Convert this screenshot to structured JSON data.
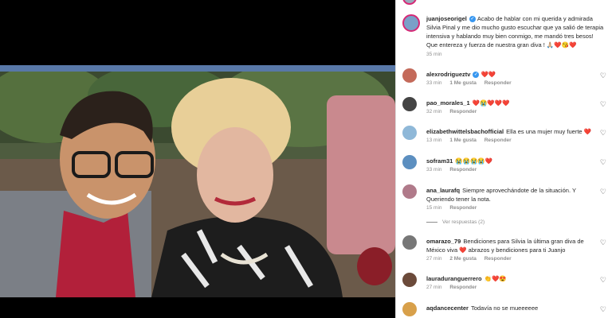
{
  "post": {
    "caption": {
      "username": "juanjoseorigel",
      "text": "Acabo de hablar con mi querida y admirada Silvia Pinal y me dio mucho gusto escuchar que ya salió de terapia intensiva y hablando muy bien conmigo, me mandó tres besos! Que entereza y fuerza de nuestra gran diva ! 🙏🏼❤️😘❤️",
      "time": "35 min"
    },
    "comments": [
      {
        "username": "alexrodrigueztv",
        "verified": true,
        "text": "❤️❤️",
        "time": "33 min",
        "likes": "1 Me gusta",
        "reply": "Responder",
        "avatar_color": "#c46a5a"
      },
      {
        "username": "pao_morales_1",
        "verified": false,
        "text": "❤️😭❤️❤️❤️",
        "time": "32 min",
        "likes": "",
        "reply": "Responder",
        "avatar_color": "#444"
      },
      {
        "username": "elizabethwittelsbachofficial",
        "verified": false,
        "text": "Ella es una mujer muy fuerte ❤️",
        "time": "13 min",
        "likes": "1 Me gusta",
        "reply": "Responder",
        "avatar_color": "#8fb8d8"
      },
      {
        "username": "sofram31",
        "verified": false,
        "text": "😭😭😭😭❤️",
        "time": "33 min",
        "likes": "",
        "reply": "Responder",
        "avatar_color": "#5c8fc0"
      },
      {
        "username": "ana_laurafq",
        "verified": false,
        "text": "Siempre aprovechándote de la situación. Y Queriendo tener la nota.",
        "time": "15 min",
        "likes": "",
        "reply": "Responder",
        "avatar_color": "#b07a8a"
      },
      {
        "username": "omarazo_79",
        "verified": false,
        "text": "Bendiciones para Silvia la última gran diva de México viva ❤️ abrazos y bendiciones para ti Juanjo",
        "time": "27 min",
        "likes": "2 Me gusta",
        "reply": "Responder",
        "avatar_color": "#777"
      },
      {
        "username": "lauraduranguerrero",
        "verified": false,
        "text": "👏❤️😍",
        "time": "27 min",
        "likes": "",
        "reply": "Responder",
        "avatar_color": "#6b4a3a"
      },
      {
        "username": "aqdancecenter",
        "verified": false,
        "text": "Todavía no se mueeeeee",
        "time": "",
        "likes": "",
        "reply": "",
        "avatar_color": "#d8a04a"
      }
    ],
    "view_replies": "Ver respuestas (2)"
  }
}
